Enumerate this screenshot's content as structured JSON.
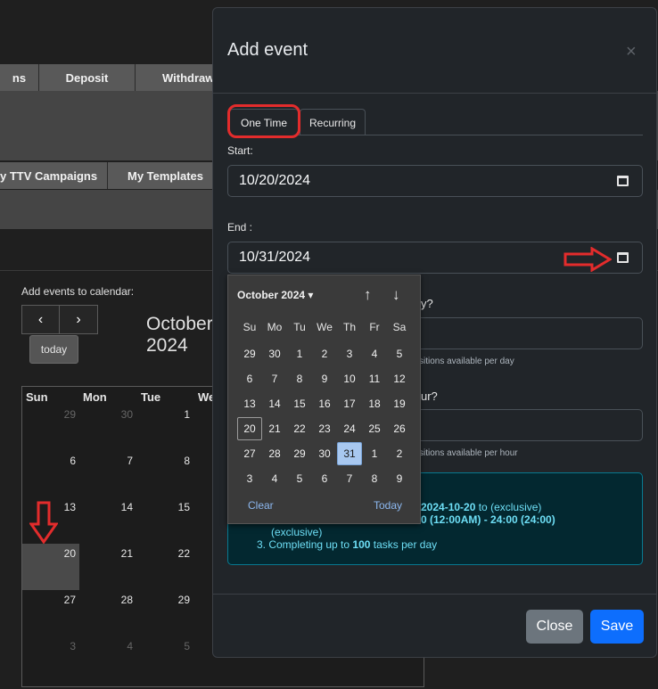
{
  "nav_row1": [
    "ns",
    "Deposit",
    "Withdraw"
  ],
  "nav_row2": [
    "y TTV Campaigns",
    "My Templates"
  ],
  "calendar": {
    "add_label": "Add events to calendar:",
    "prev": "‹",
    "next": "›",
    "today": "today",
    "title_line1": "October",
    "title_line2": "2024",
    "headers": [
      "Sun",
      "Mon",
      "Tue",
      "We"
    ],
    "weeks": [
      [
        "29",
        "30",
        "1"
      ],
      [
        "6",
        "7",
        "8"
      ],
      [
        "13",
        "14",
        "15"
      ],
      [
        "20",
        "21",
        "22"
      ],
      [
        "27",
        "28",
        "29"
      ],
      [
        "3",
        "4",
        "5"
      ]
    ]
  },
  "modal": {
    "title": "Add event",
    "close_symbol": "×",
    "tabs": [
      "One Time",
      "Recurring"
    ],
    "start_label": "Start:",
    "start_value": "10/20/2024",
    "end_label": "End :",
    "end_value": "10/31/2024",
    "q1_suffix": "y?",
    "q1_help": "sitions available per day",
    "q2_suffix": "ur?",
    "q2_help": "sitions available per hour",
    "info": {
      "line1_bold": "2024-10-20",
      "line1_rest": " to (exclusive)",
      "line2_bold": "0 (12:00AM) - 24:00 (24:00)",
      "line3": "(exclusive)",
      "item3_prefix": "3. Completing up to ",
      "item3_bold": "100",
      "item3_suffix": " tasks per day"
    },
    "close_button": "Close",
    "save_button": "Save"
  },
  "picker": {
    "month_label": "October 2024 ▾",
    "up": "↑",
    "down": "↓",
    "dow": [
      "Su",
      "Mo",
      "Tu",
      "We",
      "Th",
      "Fr",
      "Sa"
    ],
    "weeks": [
      [
        "29",
        "30",
        "1",
        "2",
        "3",
        "4",
        "5"
      ],
      [
        "6",
        "7",
        "8",
        "9",
        "10",
        "11",
        "12"
      ],
      [
        "13",
        "14",
        "15",
        "16",
        "17",
        "18",
        "19"
      ],
      [
        "20",
        "21",
        "22",
        "23",
        "24",
        "25",
        "26"
      ],
      [
        "27",
        "28",
        "29",
        "30",
        "31",
        "1",
        "2"
      ],
      [
        "3",
        "4",
        "5",
        "6",
        "7",
        "8",
        "9"
      ]
    ],
    "outlined_day": "20",
    "selected_day": "31",
    "clear": "Clear",
    "today": "Today"
  },
  "colors": {
    "accent_red": "#e32c2c",
    "primary": "#0d6efd",
    "info_text": "#6edff6"
  }
}
